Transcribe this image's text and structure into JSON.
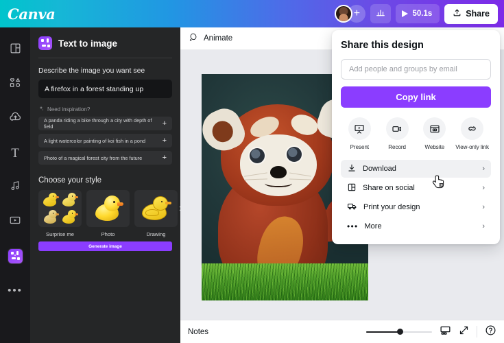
{
  "topbar": {
    "logo": "Canva",
    "avatar_name": "user-avatar",
    "add_label": "+",
    "stats_icon": "bar-chart-icon",
    "play_icon": "play-icon",
    "duration": "50.1s",
    "share_label": "Share",
    "share_icon": "upload-icon"
  },
  "rail": {
    "items": [
      {
        "name": "design",
        "icon": "layout-icon"
      },
      {
        "name": "elements",
        "icon": "shapes-icon"
      },
      {
        "name": "uploads",
        "icon": "cloud-upload-icon"
      },
      {
        "name": "text",
        "icon": "text-T-icon",
        "glyph": "T"
      },
      {
        "name": "audio",
        "icon": "music-note-icon"
      },
      {
        "name": "videos",
        "icon": "video-frame-icon"
      },
      {
        "name": "apps",
        "icon": "apps-icon",
        "active": true
      },
      {
        "name": "more",
        "icon": "ellipsis-icon",
        "glyph": "•••"
      }
    ]
  },
  "panel": {
    "title": "Text to image",
    "title_icon": "text-to-image-icon",
    "describe_label": "Describe the image you want see",
    "prompt_value": "A firefox in a forest standing up",
    "prompt_placeholder": "Describe the image you want see",
    "inspiration_label": "Need inspiration?",
    "inspiration_icon": "sparkle-icon",
    "suggestions": [
      {
        "text": "A panda riding a bike through a city with depth of field",
        "add": "+"
      },
      {
        "text": "A light watercolor painting of koi fish in a pond",
        "add": "+"
      },
      {
        "text": "Photo of a magical forest city from the future",
        "add": "+"
      }
    ],
    "choose_style_label": "Choose your style",
    "styles": [
      {
        "label": "Surprise me",
        "thumb": "four-ducks-grid"
      },
      {
        "label": "Photo",
        "thumb": "photo-duck"
      },
      {
        "label": "Drawing",
        "thumb": "drawing-duck"
      }
    ],
    "styles_next_icon": "chevron-right-icon",
    "generate_label": "Generate image"
  },
  "canvas": {
    "animate_label": "Animate",
    "animate_icon": "animate-sparkle-icon",
    "artwork_alt": "AI generated red panda standing on grass",
    "artwork_subject": "red panda",
    "artwork_ground": "grass"
  },
  "bottombar": {
    "notes_label": "Notes",
    "zoom_value": 52,
    "pages_icon": "pages-grid-icon",
    "fullscreen_icon": "expand-arrows-icon",
    "help_icon": "help-question-icon"
  },
  "share_dialog": {
    "title": "Share this design",
    "email_placeholder": "Add people and groups by email",
    "email_value": "",
    "copy_link_label": "Copy link",
    "quick_actions": [
      {
        "label": "Present",
        "icon": "present-screen-icon"
      },
      {
        "label": "Record",
        "icon": "video-camera-icon"
      },
      {
        "label": "Website",
        "icon": "website-window-icon"
      },
      {
        "label": "View-only link",
        "icon": "link-chain-icon"
      }
    ],
    "menu": [
      {
        "label": "Download",
        "icon": "download-icon",
        "chevron": "›",
        "hovered": true
      },
      {
        "label": "Share on social",
        "icon": "social-grid-icon",
        "chevron": "›",
        "hovered": false
      },
      {
        "label": "Print your design",
        "icon": "delivery-truck-icon",
        "chevron": "›",
        "hovered": false
      },
      {
        "label": "More",
        "icon": "ellipsis-icon",
        "chevron": "›",
        "hovered": false
      }
    ]
  },
  "colors": {
    "brand_purple": "#8b3dff",
    "topbar_teal": "#00c4cc",
    "topbar_purple": "#7d2ae8",
    "panel_bg": "#252627",
    "rail_bg": "#19191c",
    "canvas_bg": "#e9eaee"
  }
}
